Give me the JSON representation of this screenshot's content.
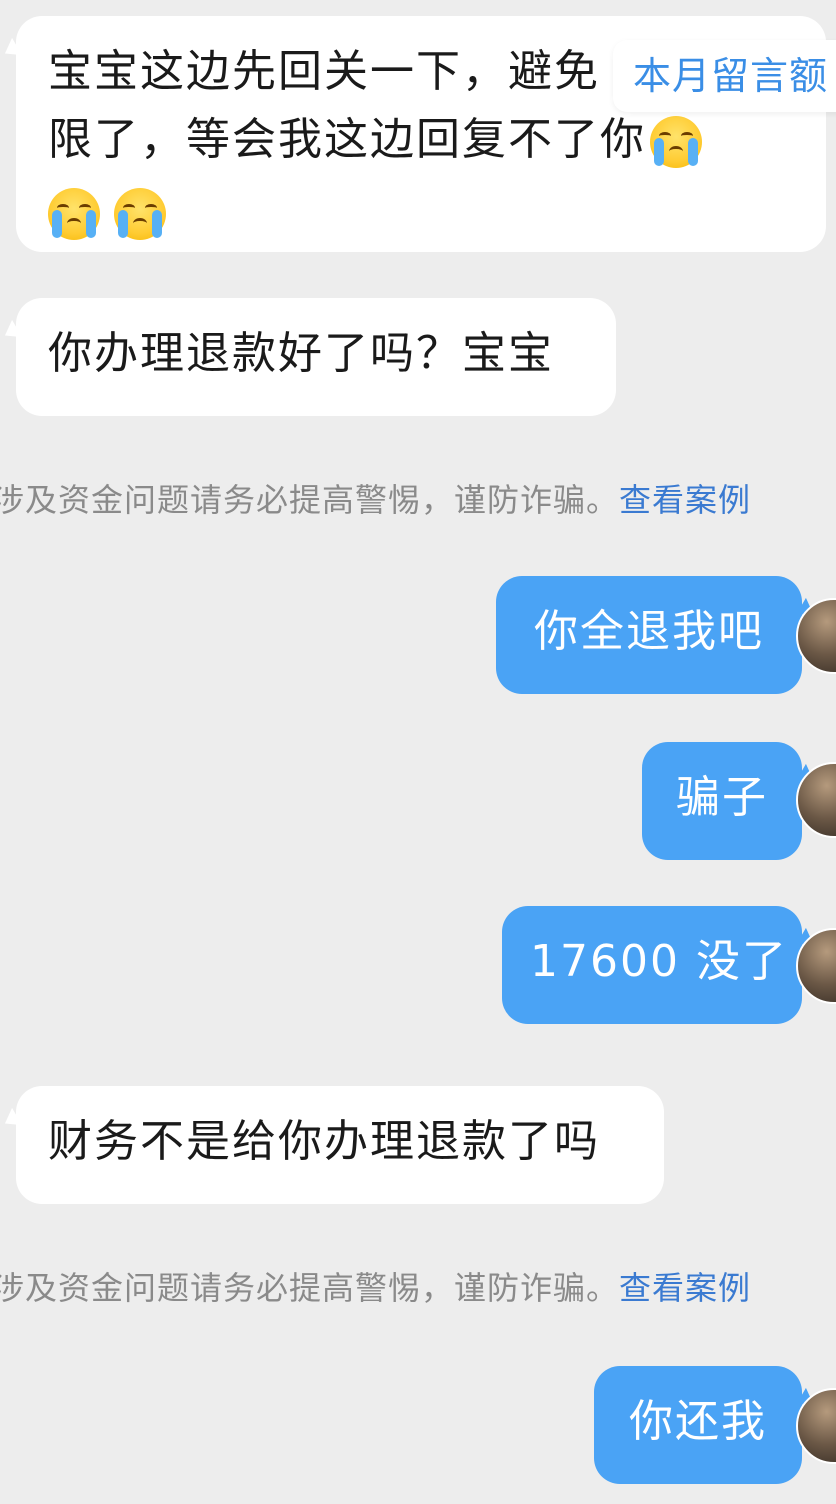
{
  "messages": {
    "m1_line1": "宝宝这边先回关一下，避免",
    "m1_line2": "限了，等会我这边回复不了你",
    "m2": "你办理退款好了吗？宝宝",
    "m3": "你全退我吧",
    "m4": "骗子",
    "m5": "17600 没了",
    "m6": "财务不是给你办理退款了吗",
    "m7": "你还我"
  },
  "notice": {
    "text": "涉及资金问题请务必提高警惕，谨防诈骗。",
    "link": "查看案例"
  },
  "pill": {
    "label": "本月留言额"
  },
  "icons": {
    "emoji": "crying-face-icon",
    "avatar": "user-avatar"
  },
  "colors": {
    "background": "#ededed",
    "incoming_bubble": "#ffffff",
    "outgoing_bubble": "#4aa3f5",
    "link": "#3a7ad1"
  }
}
